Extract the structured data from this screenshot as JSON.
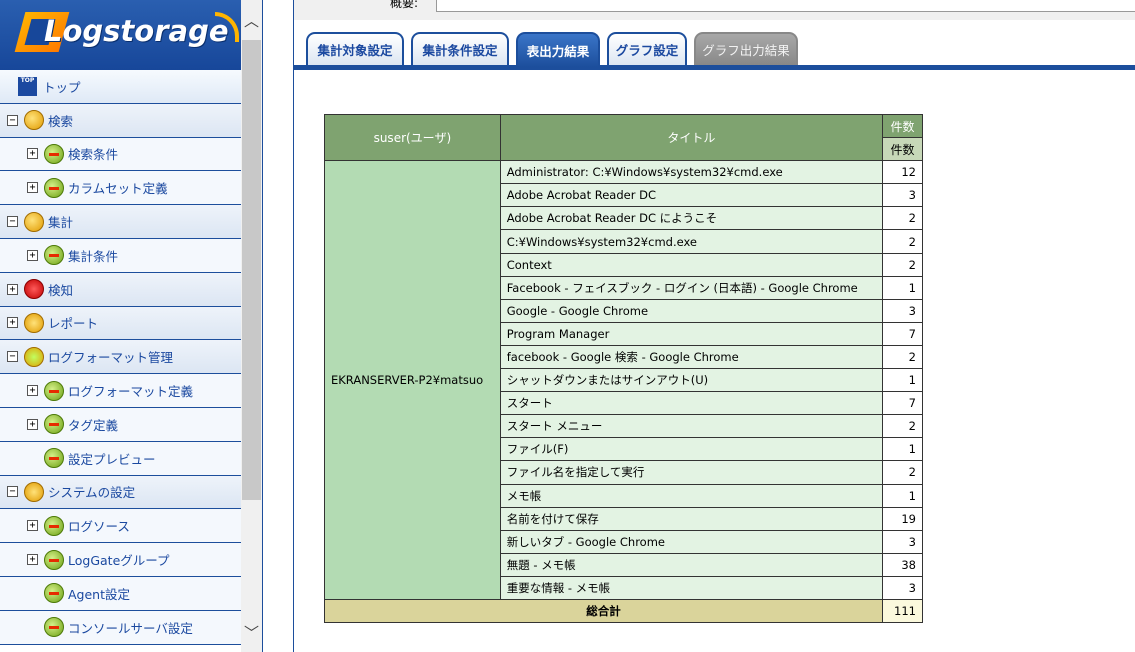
{
  "app": {
    "logo_text": "Logstorage"
  },
  "sidebar": {
    "items": [
      {
        "label": "トップ",
        "level": "top",
        "icon": "top-icon"
      },
      {
        "label": "検索",
        "level": "l1",
        "expander": "⊟",
        "icon": "search-icon"
      },
      {
        "label": "検索条件",
        "level": "l2",
        "expander": "⊞",
        "icon": "arrow-icon"
      },
      {
        "label": "カラムセット定義",
        "level": "l2",
        "expander": "⊞",
        "icon": "arrow-icon"
      },
      {
        "label": "集計",
        "level": "l1",
        "expander": "⊟",
        "icon": "chart-icon"
      },
      {
        "label": "集計条件",
        "level": "l2",
        "expander": "⊞",
        "icon": "arrow-icon"
      },
      {
        "label": "検知",
        "level": "l1",
        "expander": "⊞",
        "icon": "detect-icon"
      },
      {
        "label": "レポート",
        "level": "l1",
        "expander": "⊞",
        "icon": "report-icon"
      },
      {
        "label": "ログフォーマット管理",
        "level": "l1",
        "expander": "⊟",
        "icon": "format-icon"
      },
      {
        "label": "ログフォーマット定義",
        "level": "l2",
        "expander": "⊞",
        "icon": "arrow-icon"
      },
      {
        "label": "タグ定義",
        "level": "l2",
        "expander": "⊞",
        "icon": "arrow-icon"
      },
      {
        "label": "設定プレビュー",
        "level": "l2",
        "expander": "",
        "icon": "arrow-icon"
      },
      {
        "label": "システムの設定",
        "level": "l1",
        "expander": "⊟",
        "icon": "system-icon"
      },
      {
        "label": "ログソース",
        "level": "l2",
        "expander": "⊞",
        "icon": "arrow-icon"
      },
      {
        "label": "LogGateグループ",
        "level": "l2",
        "expander": "⊞",
        "icon": "arrow-icon"
      },
      {
        "label": "Agent設定",
        "level": "l2",
        "expander": "",
        "icon": "arrow-icon"
      },
      {
        "label": "コンソールサーバ設定",
        "level": "l2",
        "expander": "",
        "icon": "arrow-icon"
      }
    ]
  },
  "summary": {
    "label": "概要:"
  },
  "tabs": [
    {
      "label": "集計対象設定",
      "state": "normal"
    },
    {
      "label": "集計条件設定",
      "state": "normal"
    },
    {
      "label": "表出力結果",
      "state": "active"
    },
    {
      "label": "グラフ設定",
      "state": "normal"
    },
    {
      "label": "グラフ出力結果",
      "state": "disabled"
    }
  ],
  "table": {
    "headers": {
      "user": "suser(ユーザ)",
      "title": "タイトル",
      "count_top": "件数",
      "count_sub": "件数"
    },
    "user_value": "EKRANSERVER-P2¥matsuo",
    "rows": [
      {
        "title": "Administrator: C:¥Windows¥system32¥cmd.exe",
        "count": "12"
      },
      {
        "title": "Adobe Acrobat Reader DC",
        "count": "3"
      },
      {
        "title": "Adobe Acrobat Reader DC にようこそ",
        "count": "2"
      },
      {
        "title": "C:¥Windows¥system32¥cmd.exe",
        "count": "2"
      },
      {
        "title": "Context",
        "count": "2"
      },
      {
        "title": "Facebook - フェイスブック - ログイン (日本語) - Google Chrome",
        "count": "1"
      },
      {
        "title": "Google - Google Chrome",
        "count": "3"
      },
      {
        "title": "Program Manager",
        "count": "7"
      },
      {
        "title": "facebook - Google 検索 - Google Chrome",
        "count": "2"
      },
      {
        "title": "シャットダウンまたはサインアウト(U)",
        "count": "1"
      },
      {
        "title": "スタート",
        "count": "7"
      },
      {
        "title": "スタート メニュー",
        "count": "2"
      },
      {
        "title": "ファイル(F)",
        "count": "1"
      },
      {
        "title": "ファイル名を指定して実行",
        "count": "2"
      },
      {
        "title": "メモ帳",
        "count": "1"
      },
      {
        "title": "名前を付けて保存",
        "count": "19"
      },
      {
        "title": "新しいタブ - Google Chrome",
        "count": "3"
      },
      {
        "title": "無題 - メモ帳",
        "count": "38"
      },
      {
        "title": "重要な情報 - メモ帳",
        "count": "3"
      }
    ],
    "total_label": "総合計",
    "total_value": "111"
  }
}
